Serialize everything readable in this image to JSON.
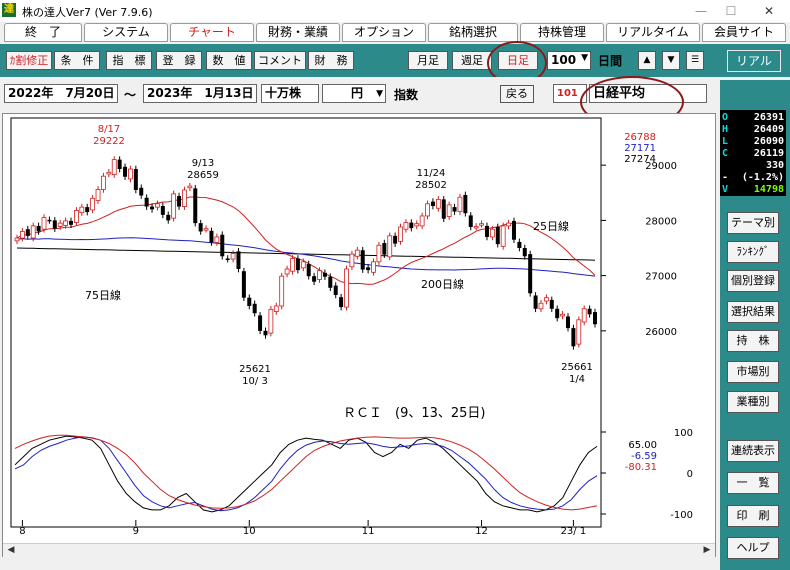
{
  "window": {
    "icon_glyph": "達",
    "title": "株の達人Ver7 (Ver 7.9.6)",
    "minimize": "—",
    "maximize": "☐",
    "close": "✕"
  },
  "menu_tabs": [
    {
      "label": "終　了",
      "active": false
    },
    {
      "label": "システム",
      "active": false
    },
    {
      "label": "チャート",
      "active": true
    },
    {
      "label": "財務・業績",
      "active": false
    },
    {
      "label": "オプション",
      "active": false
    },
    {
      "label": "銘柄選択",
      "active": false
    },
    {
      "label": "持株管理",
      "active": false
    },
    {
      "label": "リアルタイム",
      "active": false
    },
    {
      "label": "会員サイト",
      "active": false
    }
  ],
  "toolbar": {
    "buttons": [
      "ｶ割修正",
      "条　件",
      "指　標",
      "登　録",
      "数　値",
      "コメント",
      "財　務"
    ],
    "period_buttons": [
      "月足",
      "週足",
      "日足"
    ],
    "count_value": "100",
    "count_unit": "日間",
    "up_arrow": "▲",
    "down_arrow": "▼",
    "menu_glyph": "☰",
    "real_label": "リアル"
  },
  "daterow": {
    "start_date": "2022年　7月20日",
    "tilde": "～",
    "end_date": "2023年　1月13日",
    "unit": "十万株",
    "currency": "円",
    "index_label": "指数",
    "back_button": "戻る",
    "code": "101",
    "name": "日経平均"
  },
  "quote": {
    "rows": [
      {
        "k": "O",
        "v": "26391"
      },
      {
        "k": "H",
        "v": "26409"
      },
      {
        "k": "L",
        "v": "26090"
      },
      {
        "k": "C",
        "v": "26119"
      },
      {
        "k": "",
        "v": "330"
      },
      {
        "k": "-",
        "v": "(-1.2%)"
      },
      {
        "k": "V",
        "v": "14798"
      }
    ]
  },
  "side_buttons": [
    "テーマ別",
    "ﾗﾝｷﾝｸﾞ",
    "個別登録",
    "選択結果",
    "持　株",
    "市場別",
    "業種別",
    "連続表示",
    "一　覧",
    "印　刷",
    "ヘルプ"
  ],
  "chart_data": [
    {
      "type": "candlestick",
      "ylim": [
        25400,
        29600
      ],
      "yticks": [
        "29000",
        "28000",
        "27000",
        "26000"
      ],
      "xticks": [
        "8",
        "9",
        "10",
        "11",
        "12",
        "23/ 1"
      ],
      "right_values": [
        {
          "value": "26788",
          "color": "#d02020"
        },
        {
          "value": "27171",
          "color": "#2020c0"
        },
        {
          "value": "27274",
          "color": "#000000"
        }
      ],
      "ma_labels": {
        "ma25": "25日線",
        "ma75": "75日線",
        "ma200": "200日線"
      },
      "annotations": [
        {
          "date": "8/17",
          "value": "29222"
        },
        {
          "date": "9/13",
          "value": "28659"
        },
        {
          "value": "25621",
          "date": "10/ 3"
        },
        {
          "date": "11/24",
          "value": "28502"
        },
        {
          "value": "25661",
          "date": "1/4"
        }
      ],
      "closes": [
        27680,
        27800,
        27720,
        27900,
        27800,
        28050,
        28000,
        27850,
        27950,
        27990,
        27920,
        28180,
        28240,
        28150,
        28400,
        28560,
        28800,
        28870,
        29100,
        28930,
        28790,
        28930,
        28550,
        28450,
        28250,
        28200,
        28300,
        28100,
        28000,
        28480,
        28250,
        28550,
        28620,
        27950,
        27800,
        27850,
        27600,
        27700,
        27350,
        27300,
        27400,
        27120,
        26600,
        26450,
        26320,
        26000,
        25920,
        26390,
        26450,
        26990,
        27120,
        27310,
        27100,
        27250,
        26990,
        26890,
        27090,
        26980,
        26780,
        26650,
        26430,
        27120,
        27390,
        27460,
        27110,
        27100,
        27250,
        27550,
        27380,
        27720,
        27580,
        27880,
        27960,
        27860,
        27940,
        28080,
        28300,
        28260,
        28380,
        28030,
        28280,
        28160,
        28420,
        28130,
        27880,
        27890,
        27940,
        27700,
        27840,
        27570,
        27900,
        27950,
        27650,
        27500,
        27350,
        26680,
        26400,
        26500,
        26600,
        26400,
        26230,
        26300,
        26050,
        25720,
        26200,
        26400,
        26300,
        26120
      ]
    },
    {
      "type": "line",
      "title": "ＲＣＩ　(9、13、25日)",
      "ylim": [
        -100,
        100
      ],
      "yticks": [
        "100",
        "0",
        "-100"
      ],
      "xticks": [
        "8",
        "9",
        "10",
        "11",
        "12",
        "23/ 1"
      ],
      "series": [
        {
          "values": [
            20,
            40,
            60,
            70,
            80,
            85,
            90,
            88,
            85,
            80,
            60,
            20,
            -20,
            -50,
            -70,
            -85,
            -90,
            -90,
            -80,
            -60,
            -50,
            -70,
            -90,
            -95,
            -90,
            -80,
            -60,
            -40,
            -20,
            0,
            20,
            50,
            70,
            80,
            85,
            82,
            80,
            70,
            60,
            80,
            85,
            75,
            50,
            40,
            50,
            70,
            60,
            80,
            85,
            75,
            60,
            40,
            20,
            0,
            -20,
            -50,
            -70,
            -80,
            -85,
            -90,
            -90,
            -95,
            -90,
            -80,
            -60,
            -20,
            20,
            50,
            65
          ],
          "color": "#000000",
          "legend_value": "65.00",
          "legend_color": "#000000"
        },
        {
          "values": [
            10,
            20,
            40,
            55,
            65,
            72,
            80,
            85,
            88,
            86,
            80,
            60,
            30,
            0,
            -30,
            -55,
            -70,
            -80,
            -85,
            -80,
            -75,
            -72,
            -80,
            -88,
            -92,
            -90,
            -85,
            -75,
            -60,
            -40,
            -20,
            10,
            35,
            55,
            68,
            75,
            78,
            76,
            72,
            70,
            72,
            74,
            70,
            65,
            62,
            64,
            66,
            70,
            72,
            70,
            65,
            55,
            40,
            25,
            5,
            -15,
            -40,
            -60,
            -72,
            -80,
            -85,
            -88,
            -90,
            -88,
            -80,
            -65,
            -40,
            -20,
            -6.59
          ],
          "color": "#2020c0",
          "legend_value": "-6.59",
          "legend_color": "#2020c0"
        },
        {
          "values": [
            60,
            70,
            78,
            85,
            90,
            92,
            92,
            90,
            88,
            85,
            80,
            72,
            60,
            45,
            25,
            0,
            -20,
            -40,
            -55,
            -65,
            -72,
            -78,
            -82,
            -85,
            -86,
            -85,
            -82,
            -76,
            -68,
            -55,
            -40,
            -20,
            0,
            20,
            40,
            55,
            65,
            72,
            78,
            82,
            85,
            87,
            88,
            87,
            86,
            85,
            85,
            86,
            87,
            86,
            82,
            76,
            68,
            58,
            45,
            28,
            10,
            -10,
            -30,
            -48,
            -60,
            -70,
            -78,
            -84,
            -88,
            -90,
            -88,
            -84,
            -80.31
          ],
          "color": "#d02020",
          "legend_value": "-80.31",
          "legend_color": "#d02020"
        }
      ]
    }
  ]
}
